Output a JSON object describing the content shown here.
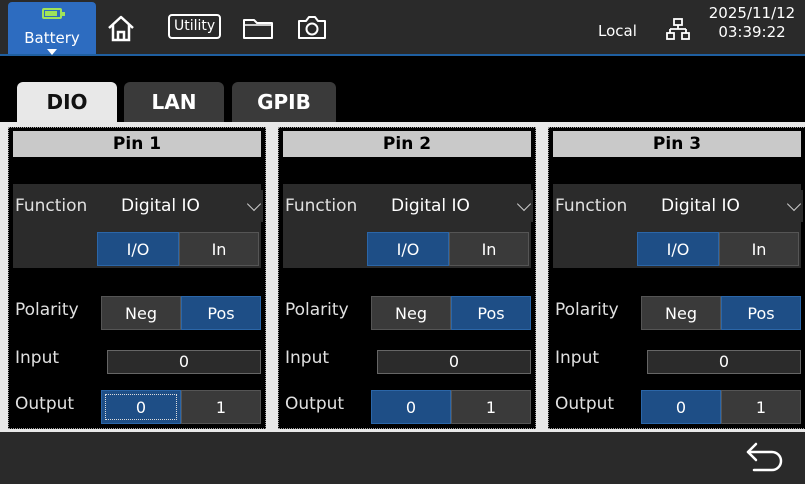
{
  "topbar": {
    "battery_label": "Battery",
    "utility_label": "Utility",
    "local_label": "Local",
    "date": "2025/11/12",
    "time": "03:39:22"
  },
  "tabs": [
    {
      "label": "DIO",
      "active": true
    },
    {
      "label": "LAN",
      "active": false
    },
    {
      "label": "GPIB",
      "active": false
    }
  ],
  "labels": {
    "function": "Function",
    "polarity": "Polarity",
    "input": "Input",
    "output": "Output",
    "io": "I/O",
    "in": "In",
    "neg": "Neg",
    "pos": "Pos",
    "zero": "0",
    "one": "1"
  },
  "pins": [
    {
      "title": "Pin 1",
      "function": "Digital IO",
      "direction": "I/O",
      "polarity": "Pos",
      "input": "0",
      "output": "0"
    },
    {
      "title": "Pin 2",
      "function": "Digital IO",
      "direction": "I/O",
      "polarity": "Pos",
      "input": "0",
      "output": "0"
    },
    {
      "title": "Pin 3",
      "function": "Digital IO",
      "direction": "I/O",
      "polarity": "Pos",
      "input": "0",
      "output": "0"
    }
  ],
  "colors": {
    "accent": "#1e4e86",
    "battery_tab": "#2d6cc0",
    "battery_level": "#9fe35a"
  }
}
